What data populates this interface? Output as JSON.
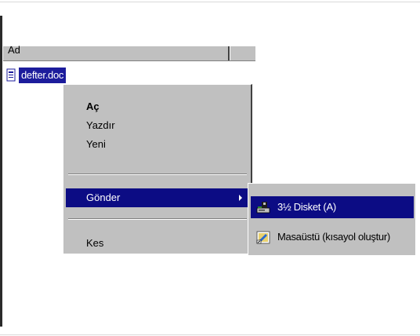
{
  "window": {
    "column_header": "Ad"
  },
  "file": {
    "name": "defter.doc"
  },
  "context_menu": {
    "items": [
      {
        "label": "Aç"
      },
      {
        "label": "Yazdır"
      },
      {
        "label": "Yeni"
      },
      {
        "label": "Gönder"
      },
      {
        "label": "Kes"
      }
    ]
  },
  "send_to_menu": {
    "items": [
      {
        "label": "3½ Disket (A)",
        "icon": "floppy-drive-icon"
      },
      {
        "label": "Masaüstü (kısayol oluştur)",
        "icon": "desktop-shortcut-icon"
      }
    ]
  },
  "colors": {
    "menu_face": "#c0c0c0",
    "selection": "#0c0c84",
    "selected_file": "#1c1c9c"
  }
}
